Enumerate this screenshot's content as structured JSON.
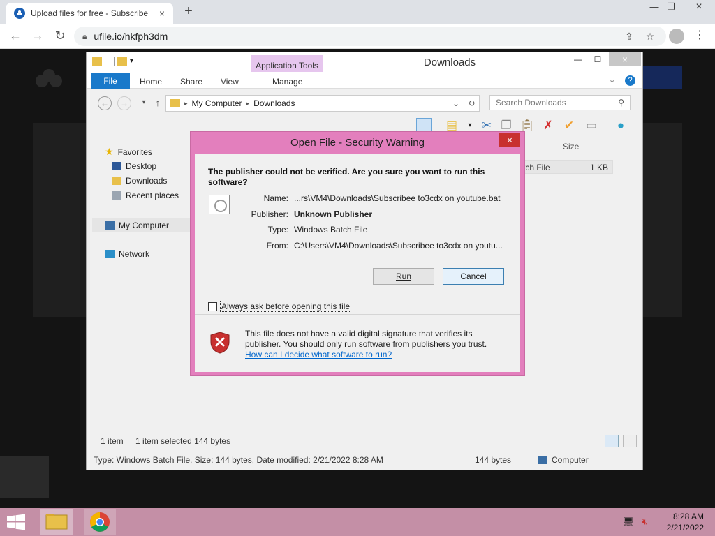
{
  "browser": {
    "tab_title": "Upload files for free - Subscribe",
    "url": "ufile.io/hkfph3dm"
  },
  "explorer": {
    "title": "Downloads",
    "contextual_tab_group": "Application Tools",
    "ribbon_tabs": [
      "File",
      "Home",
      "Share",
      "View",
      "Manage"
    ],
    "breadcrumb": [
      "My Computer",
      "Downloads"
    ],
    "search_placeholder": "Search Downloads",
    "nav": {
      "favorites": "Favorites",
      "desktop": "Desktop",
      "downloads": "Downloads",
      "recent": "Recent places",
      "computer": "My Computer",
      "network": "Network"
    },
    "column_size": "Size",
    "file_row": {
      "name": "tch File",
      "size": "1 KB"
    },
    "status": {
      "count": "1 item",
      "selected": "1 item selected  144 bytes"
    },
    "details": {
      "info": "Type: Windows Batch File, Size: 144 bytes, Date modified: 2/21/2022 8:28 AM",
      "size": "144 bytes",
      "location": "Computer"
    }
  },
  "dialog": {
    "title": "Open File - Security Warning",
    "heading": "The publisher could not be verified.  Are you sure you want to run this software?",
    "fields": {
      "name_label": "Name:",
      "name_value": "...rs\\VM4\\Downloads\\Subscribee to3cdx on youtube.bat",
      "publisher_label": "Publisher:",
      "publisher_value": "Unknown Publisher",
      "type_label": "Type:",
      "type_value": "Windows Batch File",
      "from_label": "From:",
      "from_value": "C:\\Users\\VM4\\Downloads\\Subscribee to3cdx on youtu..."
    },
    "run_label": "Run",
    "cancel_label": "Cancel",
    "checkbox_label": "Always ask before opening this file",
    "checkbox_checked": false,
    "warning_text": "This file does not have a valid digital signature that verifies its publisher.  You should only run software from publishers you trust.",
    "help_link": "How can I decide what software to run?"
  },
  "taskbar": {
    "time": "8:28 AM",
    "date": "2/21/2022"
  },
  "colors": {
    "dialog_frame": "#e37fbd",
    "taskbar": "#c48fa6",
    "accent": "#1979ca",
    "close_red": "#c8302f"
  }
}
